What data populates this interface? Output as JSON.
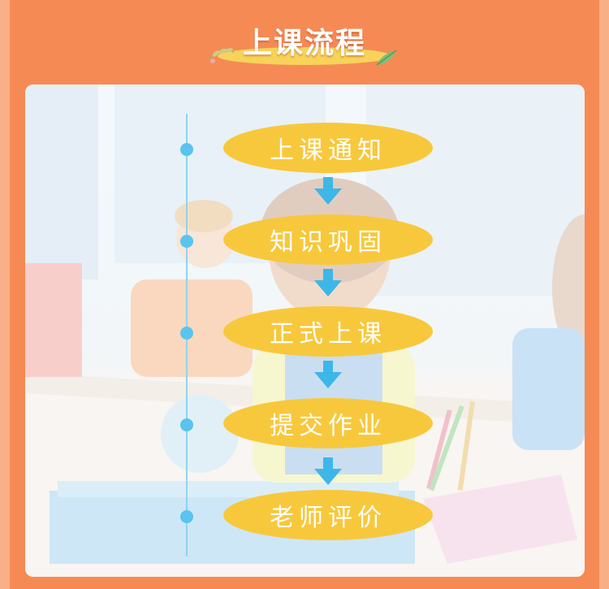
{
  "title": "上课流程",
  "steps": [
    {
      "label": "上课通知"
    },
    {
      "label": "知识巩固"
    },
    {
      "label": "正式上课"
    },
    {
      "label": "提交作业"
    },
    {
      "label": "老师评价"
    }
  ],
  "colors": {
    "background": "#f68a55",
    "step_fill": "#f8c83c",
    "arrow": "#3db7e8",
    "timeline": "#8fd4ee",
    "dot": "#59c4ee"
  }
}
